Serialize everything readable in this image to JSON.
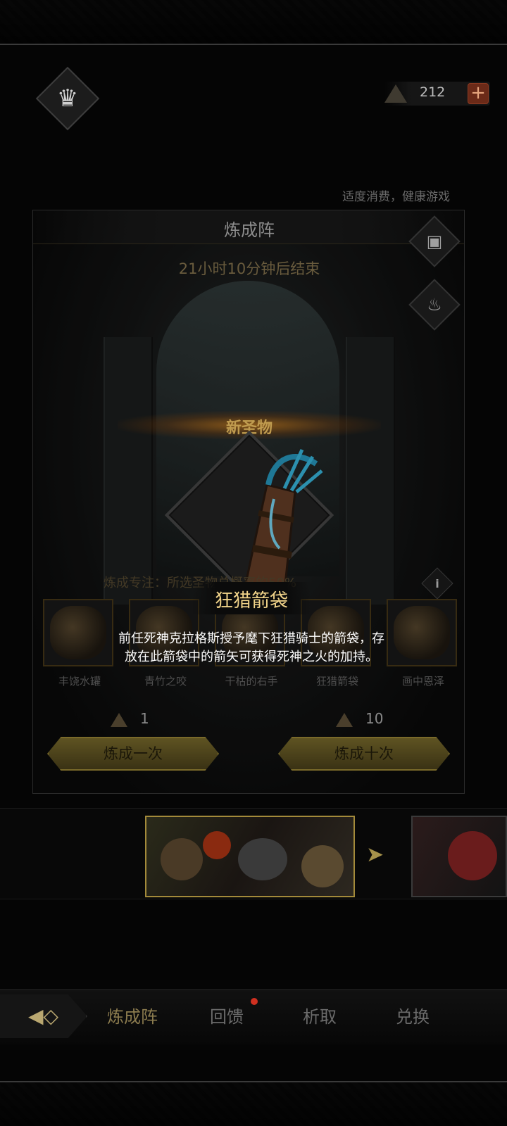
{
  "header": {
    "crown_icon": "crown-icon",
    "currency": {
      "icon": "gem-icon",
      "amount": "212",
      "add_label": "+"
    },
    "notice": "适度消费，健康游戏"
  },
  "panel": {
    "title": "炼成阵",
    "countdown": "21小时10分钟后结束",
    "side_buttons": [
      "chest-icon",
      "cauldron-icon"
    ],
    "new_relic_label": "新圣物",
    "focus_text": "炼成专注：所选圣物总概率的50%",
    "info_label": "i",
    "featured_relic": {
      "name": "狂猎箭袋",
      "description_line1": "前任死神克拉格斯授予麾下狂猎骑士的箭袋，存",
      "description_line2": "放在此箭袋中的箭矢可获得死神之火的加持。"
    },
    "relics": [
      {
        "name": "丰饶水罐"
      },
      {
        "name": "青竹之咬"
      },
      {
        "name": "干枯的右手"
      },
      {
        "name": "狂猎箭袋"
      },
      {
        "name": "画中恩泽"
      }
    ]
  },
  "actions": {
    "single": {
      "cost": "1",
      "label": "炼成一次"
    },
    "ten": {
      "cost": "10",
      "label": "炼成十次"
    }
  },
  "nav": {
    "tabs": [
      "炼成阵",
      "回馈",
      "析取",
      "兑换"
    ],
    "active_tab": "炼成阵",
    "badge_tab": "回馈"
  },
  "colors": {
    "gold": "#f2d48a",
    "orange_glow": "#e68c1e",
    "button_gold": "#5e5322",
    "badge_red": "#d03020"
  }
}
